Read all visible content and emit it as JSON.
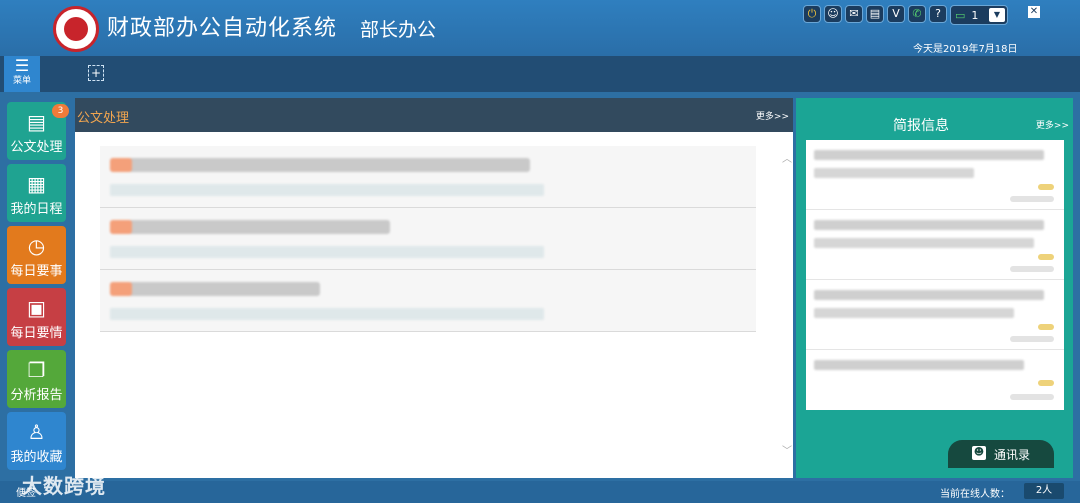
{
  "header": {
    "title": "财政部办公自动化系统",
    "subtitle": "部长办公",
    "date": "今天是2019年7月18日",
    "message_count": "1",
    "icons": [
      "power-icon",
      "user-icon",
      "mail-icon",
      "document-icon",
      "v-icon",
      "phone-icon",
      "help-icon",
      "chat-icon"
    ]
  },
  "toolbar": {
    "menu_label": "菜单",
    "add_symbol": "+"
  },
  "sidebar": {
    "items": [
      {
        "label": "公文处理",
        "color": "#1fa391",
        "badge": "3"
      },
      {
        "label": "我的日程",
        "color": "#1fa391"
      },
      {
        "label": "每日要事",
        "color": "#e27a1d"
      },
      {
        "label": "每日要情",
        "color": "#c63f44"
      },
      {
        "label": "分析报告",
        "color": "#54a83a"
      },
      {
        "label": "我的收藏",
        "color": "#2f86cf"
      }
    ]
  },
  "main": {
    "title": "公文处理",
    "more": "更多>>"
  },
  "right": {
    "title": "简报信息",
    "more": "更多>>",
    "contacts_label": "通讯录"
  },
  "footer": {
    "note": "便签",
    "watermark": "大数跨境",
    "online_label": "当前在线人数：",
    "online_count": "2人"
  },
  "colors": {
    "header_bg": "#2f7fbf",
    "panel_dark": "#324a5e",
    "teal": "#1ba595",
    "accent_orange": "#f1a54f"
  }
}
